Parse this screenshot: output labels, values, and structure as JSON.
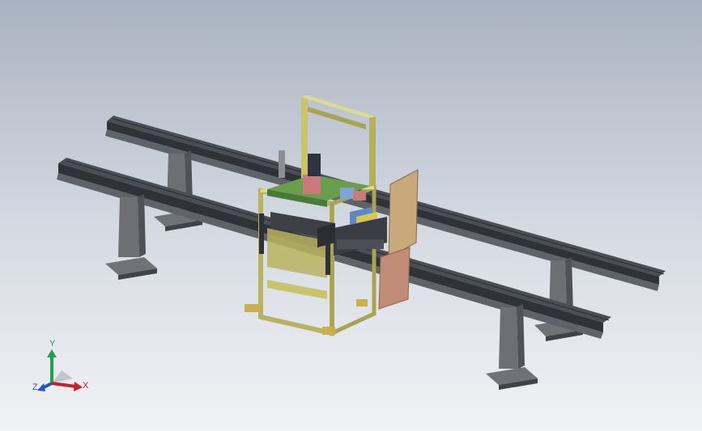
{
  "view": {
    "background_top": "#a9b2c0",
    "background_bottom": "#f1f2f5"
  },
  "model": {
    "frame_color": "#c9c46a",
    "rail_color": "#4a4e55",
    "stand_color": "#6c6f74",
    "plate_color": "#6a9e4f",
    "panel_color": "#c7a97c"
  },
  "triad": {
    "x_label": "X",
    "y_label": "Y",
    "z_label": "Z",
    "x_color": "#c8202a",
    "y_color": "#1fa24a",
    "z_color": "#2356c6"
  }
}
